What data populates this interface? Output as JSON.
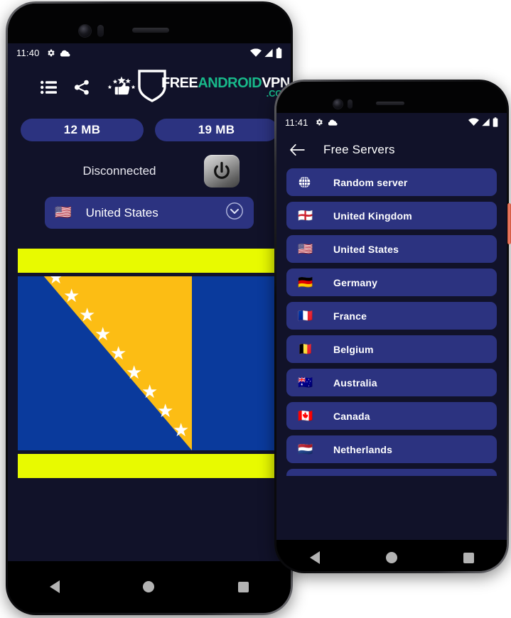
{
  "colors": {
    "screen_bg": "#111229",
    "accent_blue": "#2c3380",
    "logo_teal": "#18b98a",
    "banner_yellow": "#e8fa00",
    "flag_blue": "#0a3a9c",
    "flag_yellow": "#fcbd14",
    "side_button": "#f5826a"
  },
  "phone_primary": {
    "status_bar": {
      "time": "11:40",
      "left_icons": [
        "gear-icon",
        "cloud-icon"
      ],
      "right_icons": [
        "wifi-icon",
        "signal-icon",
        "battery-icon"
      ]
    },
    "appbar": {
      "icons": [
        "list-icon",
        "share-icon",
        "rate-thumbs-up-icon"
      ],
      "logo": {
        "part1": "FREE",
        "part2": "ANDROID",
        "part3": "VPN",
        "part4": ".COM"
      }
    },
    "stats": {
      "download_label": "12 MB",
      "upload_label": "19 MB"
    },
    "connection": {
      "status_text": "Disconnected",
      "power_button": "power-icon"
    },
    "country_selector": {
      "flag": "🇺🇸",
      "label": "United States",
      "chevron": "chevron-down-circle-icon"
    },
    "navbar": {
      "back": "back-icon",
      "home": "home-icon",
      "recents": "recents-icon"
    }
  },
  "phone_secondary": {
    "status_bar": {
      "time": "11:41",
      "left_icons": [
        "gear-icon",
        "cloud-icon"
      ],
      "right_icons": [
        "wifi-icon",
        "signal-icon",
        "battery-icon"
      ]
    },
    "appbar": {
      "back": "back-arrow-icon",
      "title": "Free Servers"
    },
    "servers": [
      {
        "flag": "globe-icon",
        "label": "Random server"
      },
      {
        "flag": "🏴󠁧󠁢󠁥󠁮󠁧󠁿",
        "label": "United Kingdom"
      },
      {
        "flag": "🇺🇸",
        "label": "United States"
      },
      {
        "flag": "🇩🇪",
        "label": "Germany"
      },
      {
        "flag": "🇫🇷",
        "label": "France"
      },
      {
        "flag": "🇧🇪",
        "label": "Belgium"
      },
      {
        "flag": "🇦🇺",
        "label": "Australia"
      },
      {
        "flag": "🇨🇦",
        "label": "Canada"
      },
      {
        "flag": "🇳🇱",
        "label": "Netherlands"
      }
    ],
    "navbar": {
      "back": "back-icon",
      "home": "home-icon",
      "recents": "recents-icon"
    }
  }
}
